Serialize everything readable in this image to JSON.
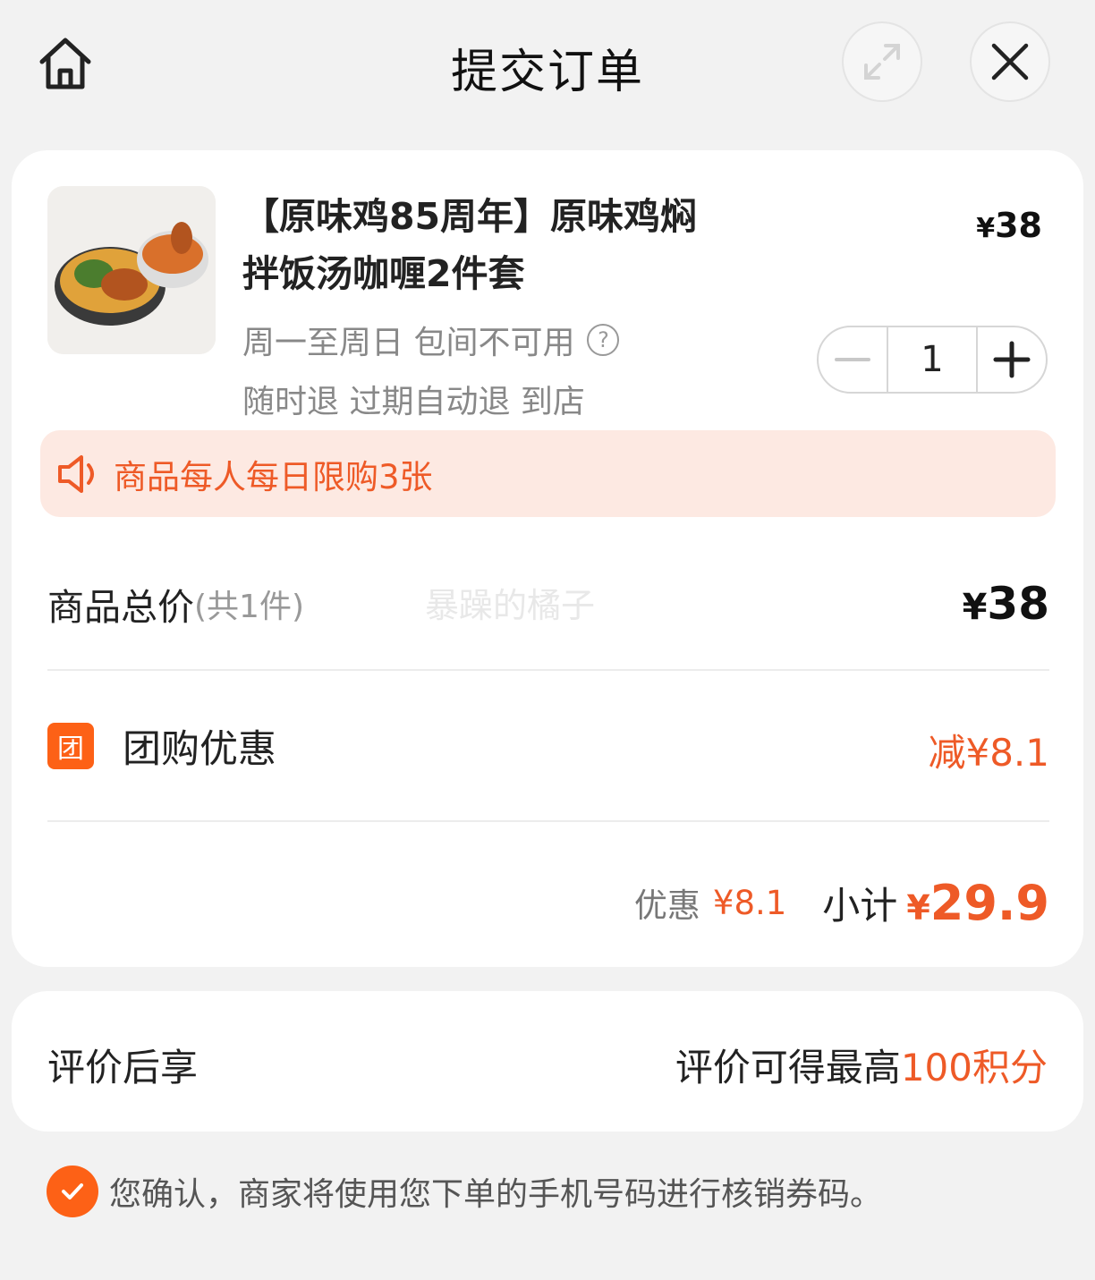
{
  "header": {
    "title": "提交订单",
    "icons": {
      "home": "home-icon",
      "expand": "expand-icon",
      "close": "close-icon"
    }
  },
  "product": {
    "name_line1": "【原味鸡85周年】原味鸡焖",
    "name_line2": "拌饭汤咖喱2件套",
    "price_symbol": "¥",
    "price": "38",
    "availability": "周一至周日 包间不可用",
    "refund_policy": "随时退 过期自动退 到店",
    "quantity": "1"
  },
  "notice": {
    "text": "商品每人每日限购3张",
    "icon": "speaker-icon"
  },
  "summary": {
    "total_label": "商品总价",
    "total_count": "(共1件)",
    "total_symbol": "¥",
    "total_value": "38",
    "watermark": "暴躁的橘子",
    "promo_badge": "团",
    "promo_label": "团购优惠",
    "promo_value": "减¥8.1",
    "discount_label": "优惠",
    "discount_value": "¥8.1",
    "subtotal_label": "小计",
    "subtotal_symbol": "¥",
    "subtotal_value": "29.9"
  },
  "review": {
    "label": "评价后享",
    "right_text": "评价可得最高",
    "right_accent": "100积分"
  },
  "confirm": {
    "text": "您确认，商家将使用您下单的手机号码进行核销券码。",
    "checked": true
  },
  "colors": {
    "accent": "#ee5a27",
    "badge": "#fd6116",
    "notice_bg": "#fde9e2",
    "page_bg": "#f2f2f2"
  }
}
